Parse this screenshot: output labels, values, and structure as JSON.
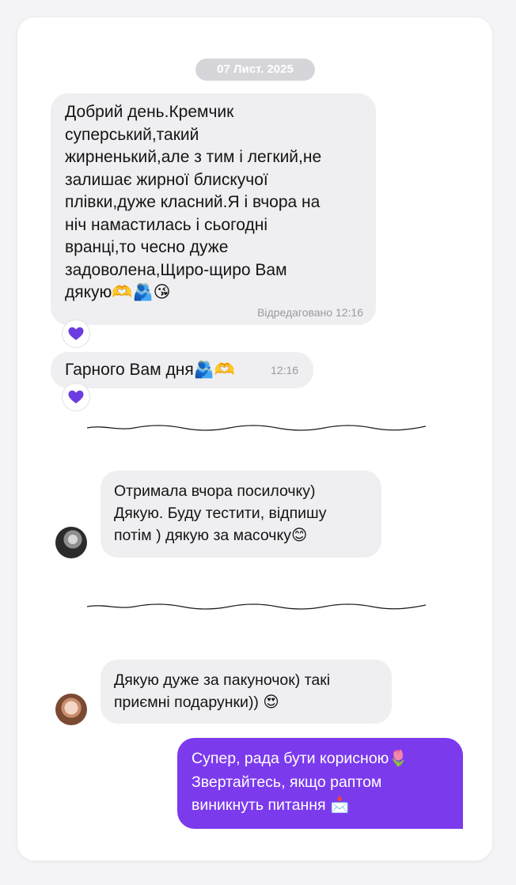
{
  "date": "07 Лист. 2025",
  "messages": [
    {
      "lines": [
        "Добрий день.Кремчик",
        "суперський,такий",
        "жирненький,але з тим і легкий,не",
        "залишає жирної блискучої",
        "плівки,дуже класний.Я і вчора на",
        "ніч намастилась і сьогодні",
        "вранці,то чесно дуже",
        "задоволена,Щиро-щиро Вам",
        "дякую🫶🫂😘"
      ],
      "meta": "Відредаговано  12:16",
      "reaction": "purple-heart"
    },
    {
      "lines": [
        "Гарного Вам дня🫂🫶"
      ],
      "meta": "12:16",
      "reaction": "purple-heart"
    },
    {
      "lines": [
        "Отримала вчора посилочку)",
        "Дякую. Буду тестити, відпишу",
        "потім ) дякую за масочку😊"
      ]
    },
    {
      "lines": [
        "Дякую дуже за пакуночок) такі",
        "приємні подарунки)) 😍"
      ]
    },
    {
      "lines": [
        "Супер, рада бути корисною🌷",
        "Звертайтесь, якщо раптом",
        "виникнуть питання 📩"
      ]
    }
  ],
  "colors": {
    "accent": "#7c3aed",
    "incoming_bubble": "#efeff1",
    "date_pill": "#d6d6da",
    "heart": "#7c3aed"
  }
}
